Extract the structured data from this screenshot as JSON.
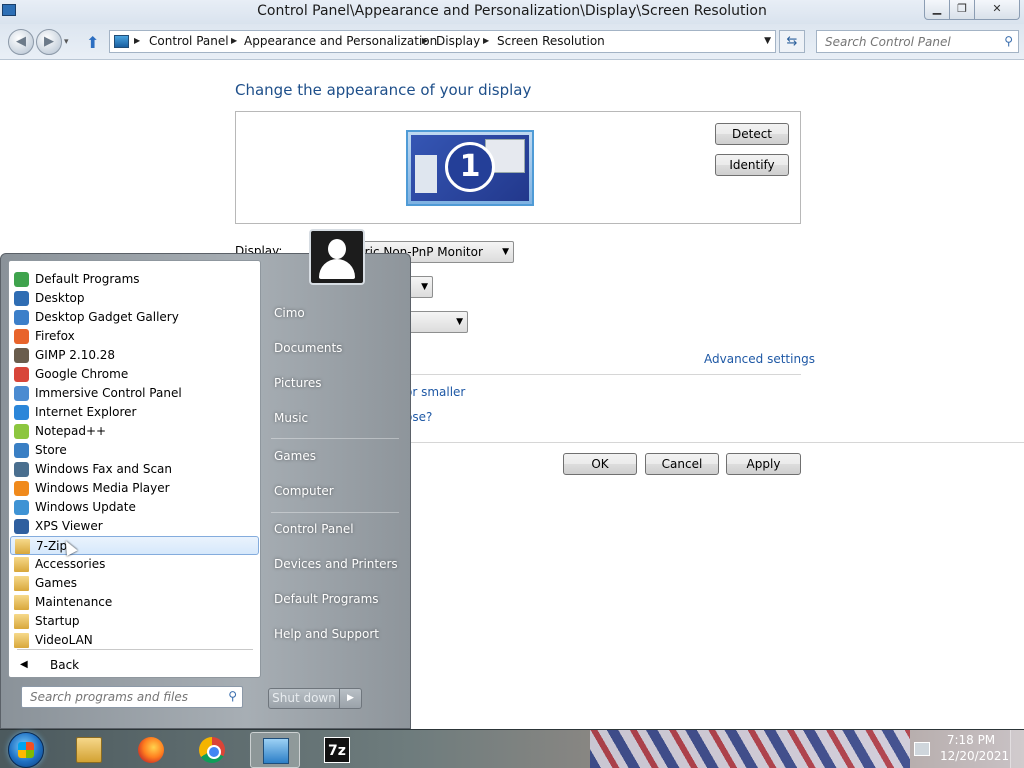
{
  "window": {
    "title": "Control Panel\\Appearance and Personalization\\Display\\Screen Resolution",
    "min_glyph": "▁",
    "max_glyph": "❐",
    "close_glyph": "✕"
  },
  "nav": {
    "back_glyph": "◀",
    "forward_glyph": "▶",
    "history_glyph": "▾",
    "up_glyph": "⬆",
    "breadcrumbs": [
      "Control Panel",
      "Appearance and Personalization",
      "Display",
      "Screen Resolution"
    ],
    "chevron_glyph": "▶",
    "dropdown_glyph": "▼",
    "refresh_glyph": "⇆",
    "search_placeholder": "Search Control Panel",
    "search_glyph": "⚲"
  },
  "main": {
    "heading": "Change the appearance of your display",
    "monitor_number": "1",
    "detect_label": "Detect",
    "identify_label": "Identify",
    "display_label": "Display:",
    "display_value": "Generic Non-PnP Monitor",
    "advanced_link": "Advanced settings",
    "link_text_larger": "or smaller",
    "link_text_settings": "ose?",
    "ok_label": "OK",
    "cancel_label": "Cancel",
    "apply_label": "Apply"
  },
  "start_menu": {
    "programs": [
      {
        "label": "Default Programs",
        "icon": "default-programs-icon",
        "color": "#3fa34d"
      },
      {
        "label": "Desktop",
        "icon": "desktop-icon",
        "color": "#2f6db3"
      },
      {
        "label": "Desktop Gadget Gallery",
        "icon": "gadget-icon",
        "color": "#3c7fc9"
      },
      {
        "label": "Firefox",
        "icon": "firefox-icon",
        "color": "#e8642b"
      },
      {
        "label": "GIMP 2.10.28",
        "icon": "gimp-icon",
        "color": "#6a5d4d"
      },
      {
        "label": "Google Chrome",
        "icon": "chrome-icon",
        "color": "#d8463a"
      },
      {
        "label": "Immersive Control Panel",
        "icon": "control-panel-icon",
        "color": "#4b8bd1"
      },
      {
        "label": "Internet Explorer",
        "icon": "internet-explorer-icon",
        "color": "#2b86d9"
      },
      {
        "label": "Notepad++",
        "icon": "notepad-plus-plus-icon",
        "color": "#8cc63f"
      },
      {
        "label": "Store",
        "icon": "store-icon",
        "color": "#3a7fc4"
      },
      {
        "label": "Windows Fax and Scan",
        "icon": "fax-icon",
        "color": "#4a6f8f"
      },
      {
        "label": "Windows Media Player",
        "icon": "media-player-icon",
        "color": "#f08a1c"
      },
      {
        "label": "Windows Update",
        "icon": "windows-update-icon",
        "color": "#3f93d4"
      },
      {
        "label": "XPS Viewer",
        "icon": "xps-viewer-icon",
        "color": "#2f5f9f"
      },
      {
        "label": "7-Zip",
        "icon": "folder-icon",
        "color": "#e2b24b"
      },
      {
        "label": "Accessories",
        "icon": "folder-icon",
        "color": "#e2b24b"
      },
      {
        "label": "Games",
        "icon": "folder-icon",
        "color": "#e2b24b"
      },
      {
        "label": "Maintenance",
        "icon": "folder-icon",
        "color": "#e2b24b"
      },
      {
        "label": "Startup",
        "icon": "folder-icon",
        "color": "#e2b24b"
      },
      {
        "label": "VideoLAN",
        "icon": "folder-icon",
        "color": "#e2b24b"
      }
    ],
    "selected_program": "7-Zip",
    "back_label": "Back",
    "back_glyph": "◀",
    "search_placeholder": "Search programs and files",
    "search_glyph": "⚲",
    "right_links": [
      "Cimo",
      "Documents",
      "Pictures",
      "Music",
      "Games",
      "Computer",
      "Control Panel",
      "Devices and Printers",
      "Default Programs",
      "Help and Support"
    ],
    "shutdown_label": "Shut down",
    "shutdown_arrow_glyph": "▶"
  },
  "taskbar": {
    "sevenzip_label": "7z",
    "clock_time": "7:18 PM",
    "clock_date": "12/20/2021"
  }
}
